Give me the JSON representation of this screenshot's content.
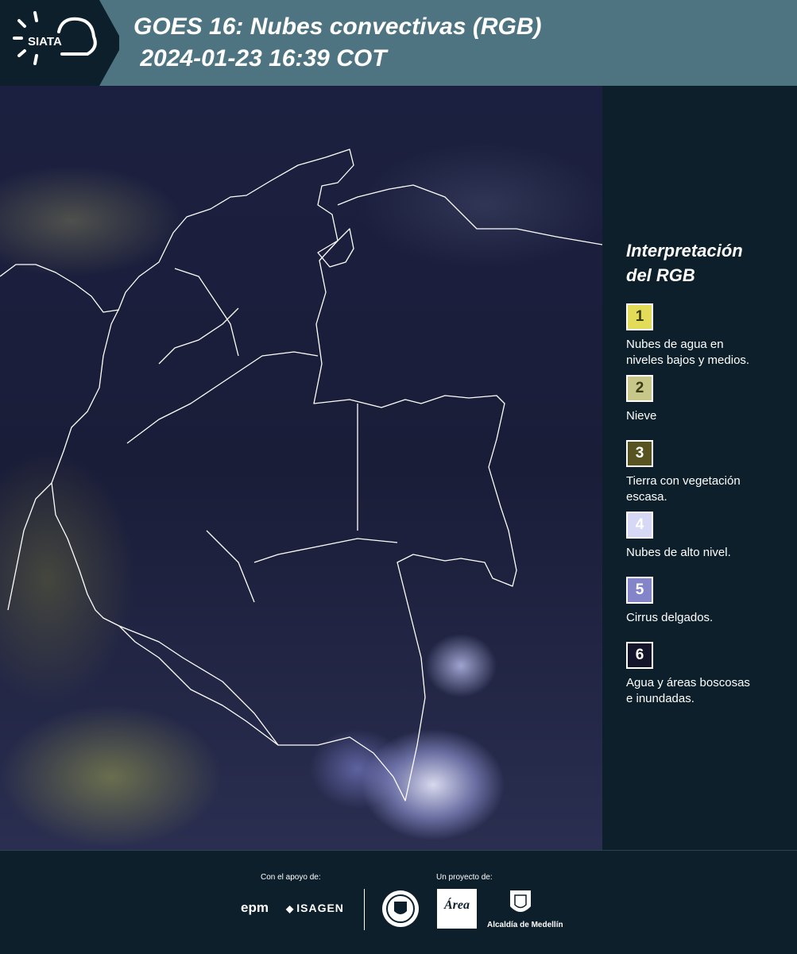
{
  "header": {
    "logo_text": "SIATA",
    "title": "GOES 16: Nubes convectivas (RGB)\n 2024-01-23 16:39 COT"
  },
  "map": {
    "icon": "satellite-rgb-image"
  },
  "legend": {
    "title": "Interpretación\ndel RGB",
    "items": [
      {
        "number": "1",
        "label": "Nubes de agua en\nniveles bajos y medios.",
        "color": "#e2dc58",
        "text_color": "#3a3a14"
      },
      {
        "number": "2",
        "label": "Nieve",
        "color": "#c7c78a",
        "text_color": "#3a3a14"
      },
      {
        "number": "3",
        "label": "Tierra con vegetación\nescasa.",
        "color": "#575421",
        "text_color": "#ffffff"
      },
      {
        "number": "4",
        "label": "Nubes de alto nivel.",
        "color": "#d6d8f6",
        "text_color": "#ffffff"
      },
      {
        "number": "5",
        "label": "Cirrus delgados.",
        "color": "#8485c9",
        "text_color": "#ffffff"
      },
      {
        "number": "6",
        "label": "Agua y áreas boscosas\ne inundadas.",
        "color": "#14152a",
        "text_color": "#ffffff"
      }
    ]
  },
  "footer": {
    "support_label": "Con el apoyo de:",
    "project_label": "Un proyecto de:",
    "epm": "epm",
    "isagen": "ISAGEN",
    "area_metropolitana": "Área",
    "alcaldia": "Alcaldía de Medellín"
  }
}
